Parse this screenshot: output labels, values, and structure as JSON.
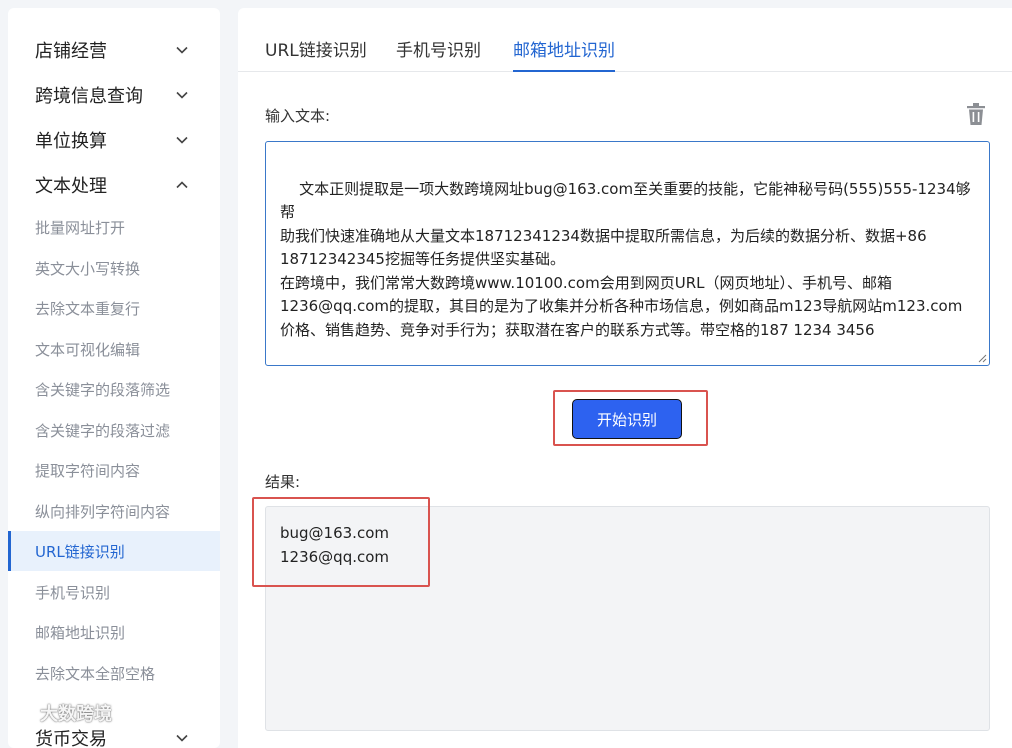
{
  "sidebar": {
    "groups": [
      {
        "label": "店铺经营",
        "state": "collapsed"
      },
      {
        "label": "跨境信息查询",
        "state": "collapsed"
      },
      {
        "label": "单位换算",
        "state": "collapsed"
      },
      {
        "label": "文本处理",
        "state": "expanded"
      }
    ],
    "items": [
      {
        "label": "批量网址打开"
      },
      {
        "label": "英文大小写转换"
      },
      {
        "label": "去除文本重复行"
      },
      {
        "label": "文本可视化编辑"
      },
      {
        "label": "含关键字的段落筛选"
      },
      {
        "label": "含关键字的段落过滤"
      },
      {
        "label": "提取字符间内容"
      },
      {
        "label": "纵向排列字符间内容"
      },
      {
        "label": "URL链接识别",
        "active": true
      },
      {
        "label": "手机号识别"
      },
      {
        "label": "邮箱地址识别"
      },
      {
        "label": "去除文本全部空格"
      }
    ],
    "partial_group": {
      "label": "货币交易"
    },
    "watermark": "大数跨境"
  },
  "tabs": [
    {
      "label": "URL链接识别"
    },
    {
      "label": "手机号识别"
    },
    {
      "label": "邮箱地址识别",
      "active": true
    }
  ],
  "input": {
    "label": "输入文本:",
    "value": "文本正则提取是一项大数跨境网址bug@163.com至关重要的技能，它能神秘号码(555)555-1234够帮\n助我们快速准确地从大量文本18712341234数据中提取所需信息，为后续的数据分析、数据+86\n18712342345挖掘等任务提供坚实基础。\n在跨境中，我们常常大数跨境www.10100.com会用到网页URL（网页地址）、手机号、邮箱\n1236@qq.com的提取，其目的是为了收集并分析各种市场信息，例如商品m123导航网站m123.com\n价格、销售趋势、竞争对手行为；获取潜在客户的联系方式等。带空格的187 1234 3456"
  },
  "action": {
    "start_label": "开始识别"
  },
  "result": {
    "label": "结果:",
    "lines": [
      "bug@163.com",
      "1236@qq.com"
    ]
  },
  "colors": {
    "accent": "#2366d1",
    "button": "#2d62f0",
    "highlight": "#d9534f"
  },
  "icons": {
    "chevron_down": "chevron-down-icon",
    "chevron_up": "chevron-up-icon",
    "trash": "trash-icon"
  }
}
